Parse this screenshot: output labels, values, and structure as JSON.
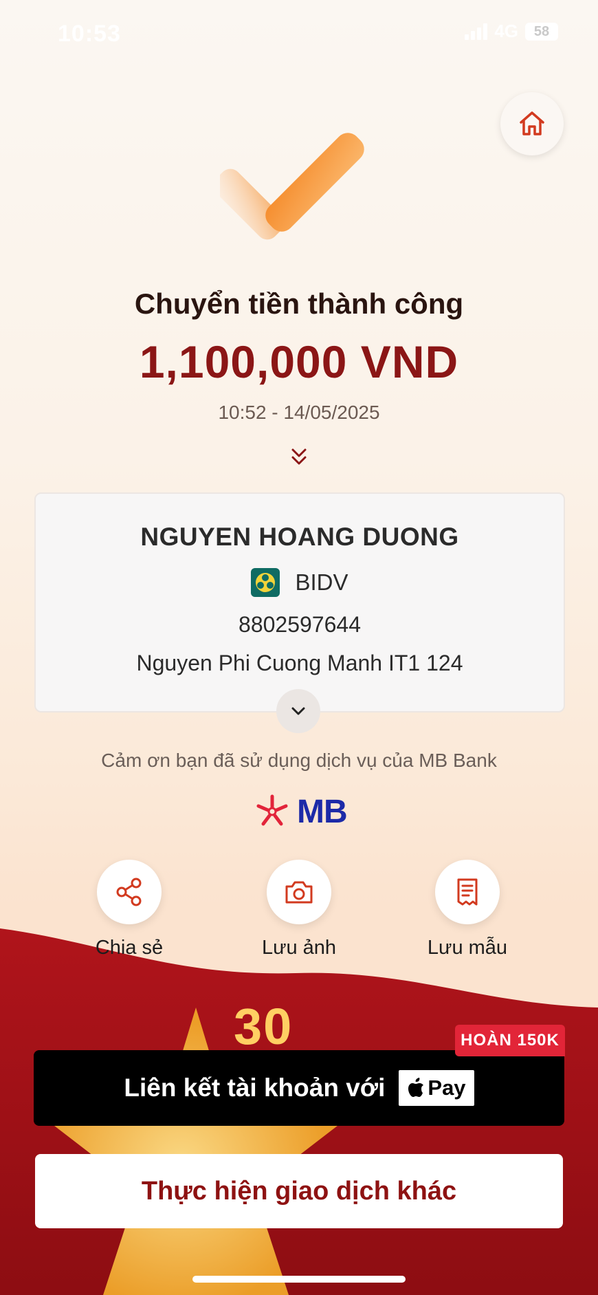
{
  "status_bar": {
    "time": "10:53",
    "network": "4G",
    "battery": "58"
  },
  "transaction": {
    "title": "Chuyển tiền thành công",
    "amount": "1,100,000 VND",
    "datetime": "10:52 - 14/05/2025"
  },
  "receiver": {
    "name": "NGUYEN HOANG DUONG",
    "bank": "BIDV",
    "account_number": "8802597644",
    "content": "Nguyen Phi Cuong Manh IT1 124"
  },
  "thanks_text": "Cảm ơn bạn đã sử dụng dịch vụ của MB Bank",
  "brand": {
    "logo_text": "MB",
    "primary_color": "#1c2aa8",
    "accent_color": "#e2243a"
  },
  "actions": [
    {
      "label": "Chia sẻ",
      "icon": "share-icon"
    },
    {
      "label": "Lưu ảnh",
      "icon": "camera-icon"
    },
    {
      "label": "Lưu mẫu",
      "icon": "receipt-icon"
    }
  ],
  "banner": {
    "text": "30"
  },
  "apple_pay": {
    "label": "Liên kết tài khoản với",
    "mark": "Pay",
    "badge": "HOÀN 150K"
  },
  "other_transaction_label": "Thực hiện giao dịch khác"
}
